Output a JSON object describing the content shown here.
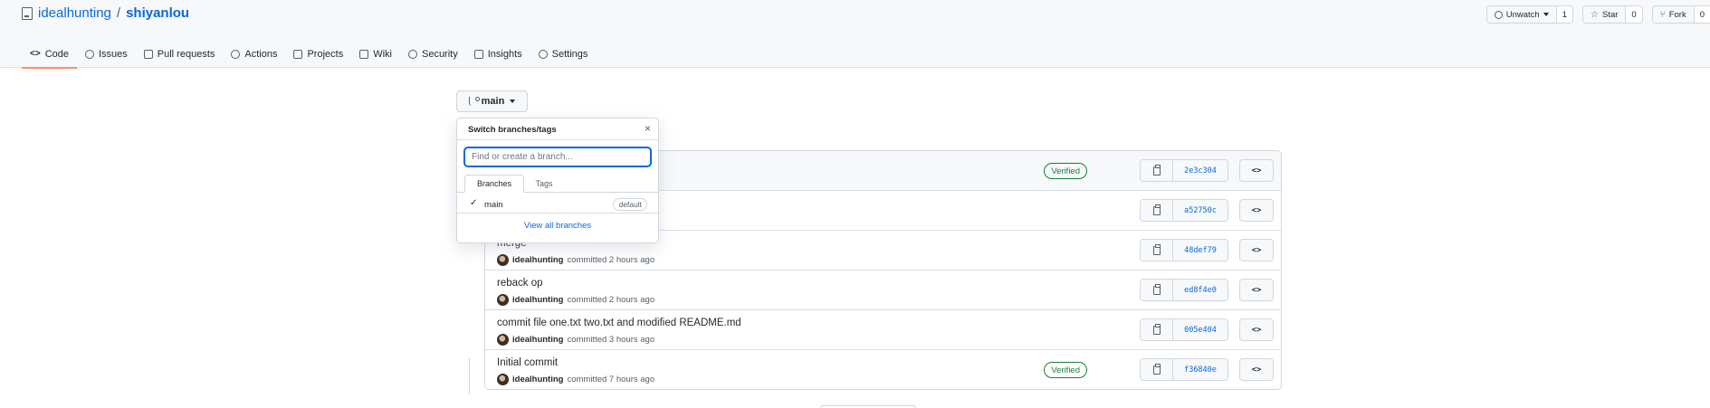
{
  "repo": {
    "owner": "idealhunting",
    "separator": "/",
    "name": "shiyanlou"
  },
  "header_actions": {
    "watch": {
      "label": "Unwatch",
      "count": "1"
    },
    "star": {
      "label": "Star",
      "count": "0"
    },
    "fork": {
      "label": "Fork",
      "count": "0"
    }
  },
  "tabs": [
    {
      "label": "Code",
      "icon": "code-icon",
      "active": true
    },
    {
      "label": "Issues",
      "icon": "issue-icon"
    },
    {
      "label": "Pull requests",
      "icon": "pull-request-icon"
    },
    {
      "label": "Actions",
      "icon": "play-icon"
    },
    {
      "label": "Projects",
      "icon": "project-icon"
    },
    {
      "label": "Wiki",
      "icon": "book-icon"
    },
    {
      "label": "Security",
      "icon": "shield-icon"
    },
    {
      "label": "Insights",
      "icon": "graph-icon"
    },
    {
      "label": "Settings",
      "icon": "gear-icon"
    }
  ],
  "branch_button": {
    "label": "main"
  },
  "dropdown": {
    "title": "Switch branches/tags",
    "close": "×",
    "search_placeholder": "Find or create a branch...",
    "tabs": [
      "Branches",
      "Tags"
    ],
    "items": [
      {
        "label": "main",
        "checked": true,
        "badge": "default"
      }
    ],
    "view_all": "View all branches"
  },
  "commits": [
    {
      "message": "",
      "author": "",
      "time": "",
      "verified": "Verified",
      "sha": "2e3c304",
      "browse": "<>"
    },
    {
      "message": "",
      "author": "",
      "time": "",
      "verified": "",
      "sha": "a52750c",
      "browse": "<>"
    },
    {
      "message": "merge",
      "author": "idealhunting",
      "time": "committed 2 hours ago",
      "verified": "",
      "sha": "48def79",
      "browse": "<>"
    },
    {
      "message": "reback op",
      "author": "idealhunting",
      "time": "committed 2 hours ago",
      "verified": "",
      "sha": "ed8f4e0",
      "browse": "<>"
    },
    {
      "message": "commit file one.txt two.txt and modified README.md",
      "author": "idealhunting",
      "time": "committed 3 hours ago",
      "verified": "",
      "sha": "005e404",
      "browse": "<>"
    },
    {
      "message": "Initial commit",
      "author": "idealhunting",
      "time": "committed 7 hours ago",
      "verified": "Verified",
      "sha": "f36840e",
      "browse": "<>"
    }
  ],
  "colors": {
    "link": "#0969da",
    "verified": "#1a7f37",
    "active_tab": "#fd8c73"
  }
}
